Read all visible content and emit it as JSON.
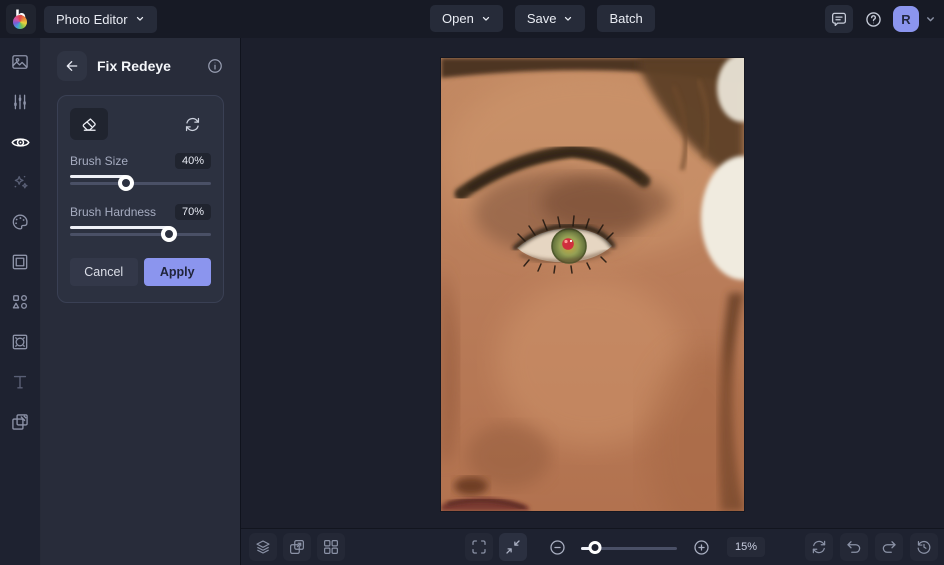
{
  "app": {
    "menu_label": "Photo Editor",
    "logo_icon": "befunky-rainbow-b-icon"
  },
  "topbar": {
    "open_label": "Open",
    "save_label": "Save",
    "batch_label": "Batch",
    "chat_icon": "chat-icon",
    "help_icon": "help-icon",
    "avatar_initial": "R"
  },
  "sidebar": {
    "tools": [
      {
        "icon": "image-icon",
        "state": "normal"
      },
      {
        "icon": "sliders-icon",
        "state": "normal"
      },
      {
        "icon": "eye-icon",
        "state": "active"
      },
      {
        "icon": "sparkles-icon",
        "state": "dim"
      },
      {
        "icon": "palette-icon",
        "state": "normal"
      },
      {
        "icon": "frame-icon",
        "state": "normal"
      },
      {
        "icon": "shapes-icon",
        "state": "normal"
      },
      {
        "icon": "ornate-frame-icon",
        "state": "normal"
      },
      {
        "icon": "text-icon",
        "state": "dim"
      },
      {
        "icon": "textures-icon",
        "state": "normal"
      }
    ]
  },
  "panel": {
    "title": "Fix Redeye",
    "back_icon": "back-arrow-icon",
    "info_icon": "info-icon",
    "eraser_icon": "eraser-icon",
    "reset_icon": "reset-icon",
    "brush_size": {
      "label": "Brush Size",
      "value": "40%",
      "percent": 40
    },
    "brush_hardness": {
      "label": "Brush Hardness",
      "value": "70%",
      "percent": 70
    },
    "cancel_label": "Cancel",
    "apply_label": "Apply"
  },
  "canvas": {
    "image_description": "Close-up of a woman's face: dark eyebrow, green eye with red-eye pupil, white flower over ear, warm bronze skin"
  },
  "bottombar": {
    "left_icons": [
      "layers-icon",
      "resize-icon",
      "grid-icon"
    ],
    "view_icons": [
      "fullscreen-icon",
      "fit-screen-icon"
    ],
    "zoom": {
      "out_icon": "zoom-out-icon",
      "in_icon": "zoom-in-icon",
      "value_label": "15%",
      "percent": 15
    },
    "right_icons": [
      "reset-icon",
      "undo-icon",
      "redo-icon",
      "history-icon"
    ]
  },
  "colors": {
    "accent": "#8b95ee",
    "topbar_bg": "#171a25",
    "panel_bg": "#282c3a",
    "canvas_bg": "#1c1f2c",
    "card_bg": "#2c3140",
    "rail_bg": "#1e2230",
    "bottombar_bg": "#1e2230"
  }
}
